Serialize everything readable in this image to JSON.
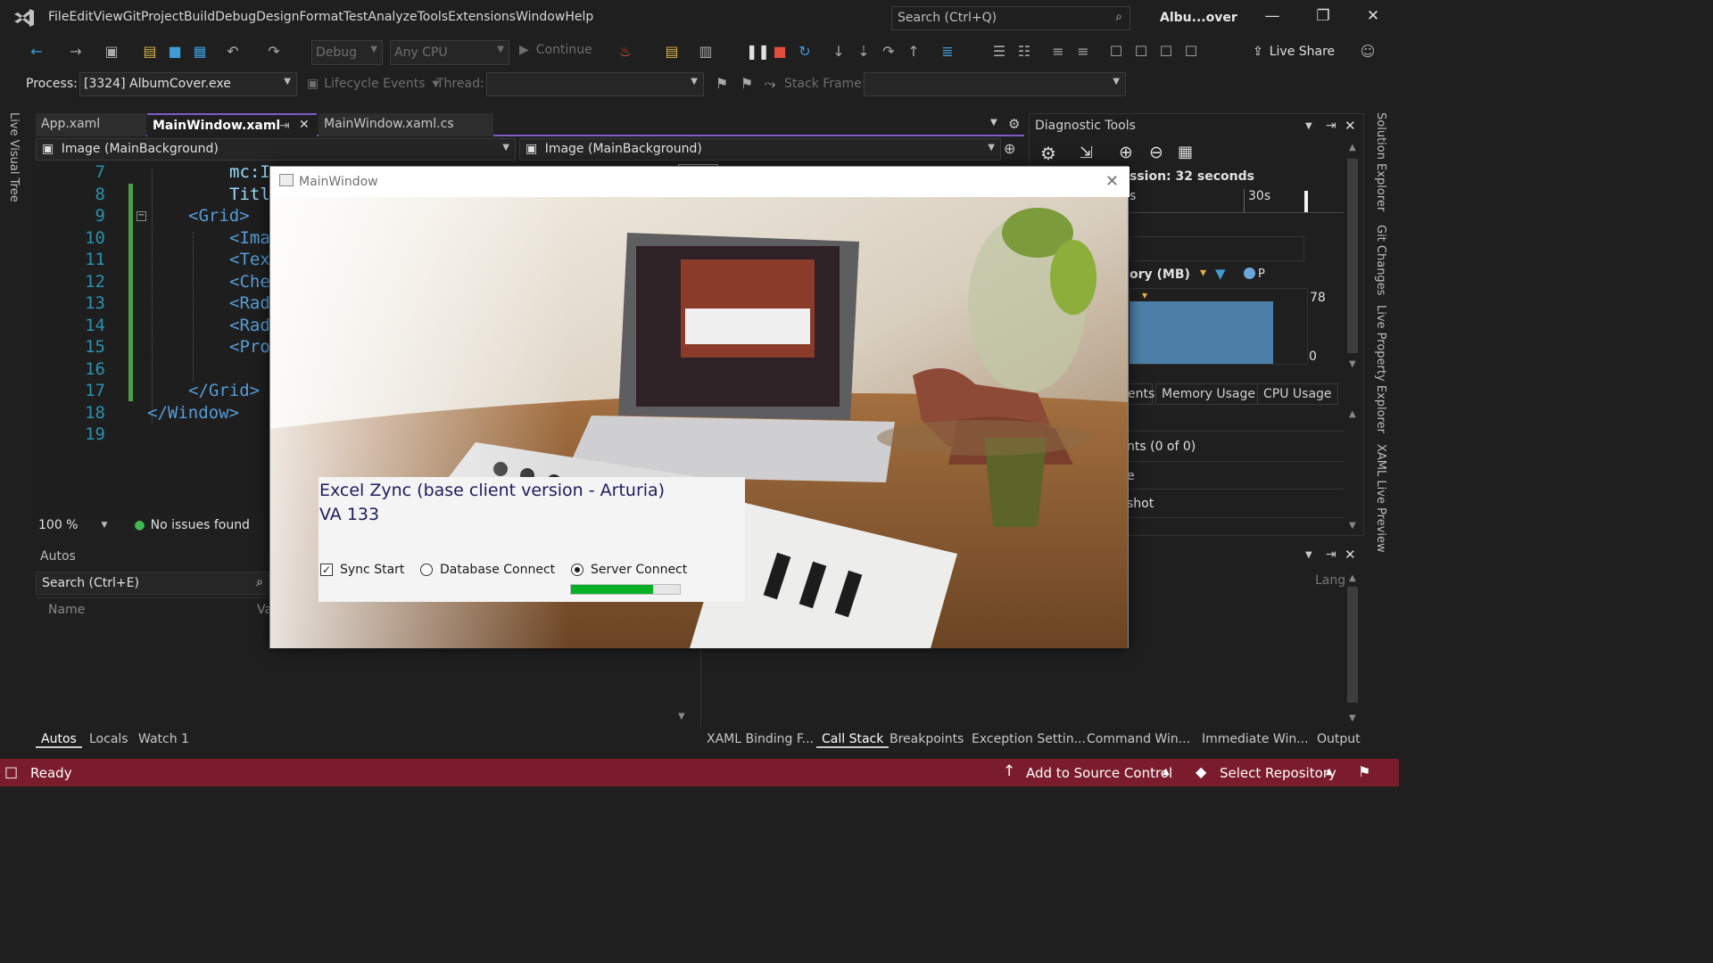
{
  "menubar": {
    "items": [
      "File",
      "Edit",
      "View",
      "Git",
      "Project",
      "Build",
      "Debug",
      "Design",
      "Format",
      "Test",
      "Analyze",
      "Tools",
      "Extensions",
      "Window",
      "Help"
    ],
    "search_placeholder": "Search (Ctrl+Q)",
    "app_title": "Albu...over"
  },
  "toolbar": {
    "config": "Debug",
    "platform": "Any CPU",
    "continue_label": "Continue",
    "live_share_label": "Live Share"
  },
  "process_bar": {
    "process_label": "Process:",
    "process_value": "[3324] AlbumCover.exe",
    "lifecycle_label": "Lifecycle Events",
    "thread_label": "Thread:",
    "stack_frame_label": "Stack Frame:"
  },
  "left_strip": {
    "label": "Live Visual Tree"
  },
  "right_strip": {
    "labels": [
      "Solution Explorer",
      "Git Changes",
      "Live Property Explorer",
      "XAML Live Preview"
    ]
  },
  "editor": {
    "tabs": [
      {
        "label": "App.xaml"
      },
      {
        "label": "MainWindow.xaml"
      },
      {
        "label": "MainWindow.xaml.cs"
      }
    ],
    "nav_left": "Image (MainBackground)",
    "nav_right": "Image (MainBackground)",
    "lines": [
      {
        "num": "7",
        "text": "mc:I"
      },
      {
        "num": "8",
        "text": "Titl"
      },
      {
        "num": "9",
        "text": "<Grid>"
      },
      {
        "num": "10",
        "text": "<Ima"
      },
      {
        "num": "11",
        "text": "<Tex"
      },
      {
        "num": "12",
        "text": "<Che"
      },
      {
        "num": "13",
        "text": "<Rad"
      },
      {
        "num": "14",
        "text": "<Rad"
      },
      {
        "num": "15",
        "text": "<Pro"
      },
      {
        "num": "16",
        "text": ""
      },
      {
        "num": "17",
        "text": "</Grid>"
      },
      {
        "num": "18",
        "text": "</Window>"
      },
      {
        "num": "19",
        "text": ""
      }
    ],
    "zoom": "100 %",
    "issues": "No issues found"
  },
  "autos": {
    "title": "Autos",
    "search_placeholder": "Search (Ctrl+E)",
    "col_name": "Name",
    "col_value": "Va",
    "tabs": [
      "Autos",
      "Locals",
      "Watch 1"
    ]
  },
  "diagnostics": {
    "title": "Diagnostic Tools",
    "session": "ssion: 32 seconds",
    "timeline_tick": "30s",
    "timeline_tick_left": "s",
    "memory_title": "ory (MB)",
    "memory_legend_p": "P",
    "memory_max": "78",
    "memory_min": "0",
    "tabs": [
      "ents",
      "Memory Usage",
      "CPU Usage"
    ],
    "list": [
      "nts (0 of 0)",
      "e",
      "shot"
    ]
  },
  "bottom_right": {
    "lang_col": "Lang",
    "tabs": [
      "XAML Binding F...",
      "Call Stack",
      "Breakpoints",
      "Exception Settin...",
      "Command Win...",
      "Immediate Win...",
      "Output"
    ]
  },
  "statusbar": {
    "ready": "Ready",
    "source_control": "Add to Source Control",
    "repository": "Select Repository"
  },
  "app_window": {
    "title": "MainWindow",
    "heading_line1": "Excel Zync (base client version - Arturia)",
    "heading_line2": "VA 133",
    "sync_label": "Sync Start",
    "sync_checked": true,
    "db_label": "Database Connect",
    "server_label": "Server Connect",
    "selected_option": "Server Connect",
    "progress": 0.75
  },
  "colors": {
    "accent": "#7a5ec5",
    "statusbar": "#7a1c2c",
    "progress": "#06b025",
    "line_numbers": "#2b91af"
  }
}
